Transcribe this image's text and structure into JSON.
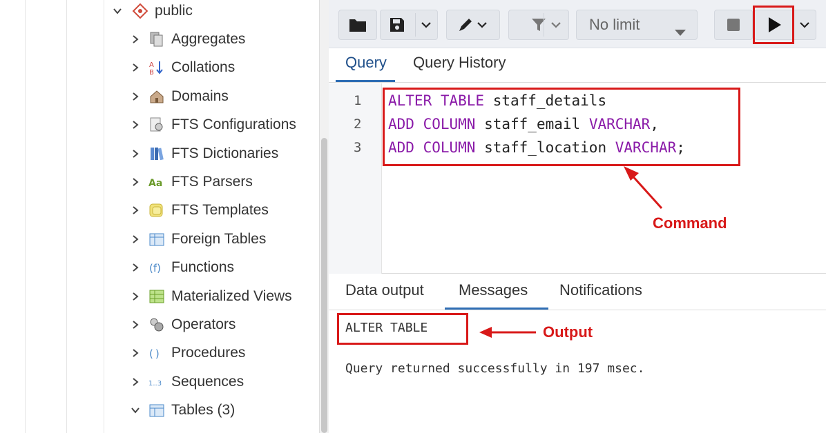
{
  "tree": {
    "root": {
      "label": "public",
      "icon": "schema-icon"
    },
    "items": [
      {
        "label": "Aggregates",
        "icon": "aggregates-icon",
        "expanded": false
      },
      {
        "label": "Collations",
        "icon": "collations-icon",
        "expanded": false
      },
      {
        "label": "Domains",
        "icon": "domains-icon",
        "expanded": false
      },
      {
        "label": "FTS Configurations",
        "icon": "fts-configurations-icon",
        "expanded": false
      },
      {
        "label": "FTS Dictionaries",
        "icon": "fts-dictionaries-icon",
        "expanded": false
      },
      {
        "label": "FTS Parsers",
        "icon": "fts-parsers-icon",
        "expanded": false
      },
      {
        "label": "FTS Templates",
        "icon": "fts-templates-icon",
        "expanded": false
      },
      {
        "label": "Foreign Tables",
        "icon": "foreign-tables-icon",
        "expanded": false
      },
      {
        "label": "Functions",
        "icon": "functions-icon",
        "expanded": false
      },
      {
        "label": "Materialized Views",
        "icon": "materialized-views-icon",
        "expanded": false
      },
      {
        "label": "Operators",
        "icon": "operators-icon",
        "expanded": false
      },
      {
        "label": "Procedures",
        "icon": "procedures-icon",
        "expanded": false
      },
      {
        "label": "Sequences",
        "icon": "sequences-icon",
        "expanded": false
      },
      {
        "label": "Tables (3)",
        "icon": "tables-icon",
        "expanded": true
      }
    ]
  },
  "toolbar": {
    "limit_label": "No limit",
    "buttons": [
      "open-file-icon",
      "save-icon",
      "edit-icon",
      "filter-icon",
      "stop-icon",
      "execute-icon"
    ]
  },
  "query_tabs": [
    {
      "label": "Query",
      "active": true
    },
    {
      "label": "Query History",
      "active": false
    }
  ],
  "editor": {
    "line_numbers": [
      "1",
      "2",
      "3"
    ],
    "lines": [
      [
        {
          "t": "ALTER TABLE",
          "kw": true
        },
        {
          "t": " staff_details",
          "kw": false
        }
      ],
      [
        {
          "t": "ADD COLUMN",
          "kw": true
        },
        {
          "t": " staff_email ",
          "kw": false
        },
        {
          "t": "VARCHAR",
          "kw": true
        },
        {
          "t": ",",
          "kw": false
        }
      ],
      [
        {
          "t": "ADD COLUMN",
          "kw": true
        },
        {
          "t": " staff_location ",
          "kw": false
        },
        {
          "t": "VARCHAR",
          "kw": true
        },
        {
          "t": ";",
          "kw": false
        }
      ]
    ]
  },
  "output_tabs": [
    {
      "label": "Data output",
      "active": false
    },
    {
      "label": "Messages",
      "active": true
    },
    {
      "label": "Notifications",
      "active": false
    }
  ],
  "messages": {
    "line1": "ALTER TABLE",
    "line2": "Query returned successfully in 197 msec."
  },
  "annotations": {
    "command": "Command",
    "output": "Output",
    "color": "#d81919"
  },
  "colors": {
    "keyword": "#8a1aa8",
    "tab_active": "#2e6db4",
    "toolbar_bg": "#eef0f4"
  }
}
